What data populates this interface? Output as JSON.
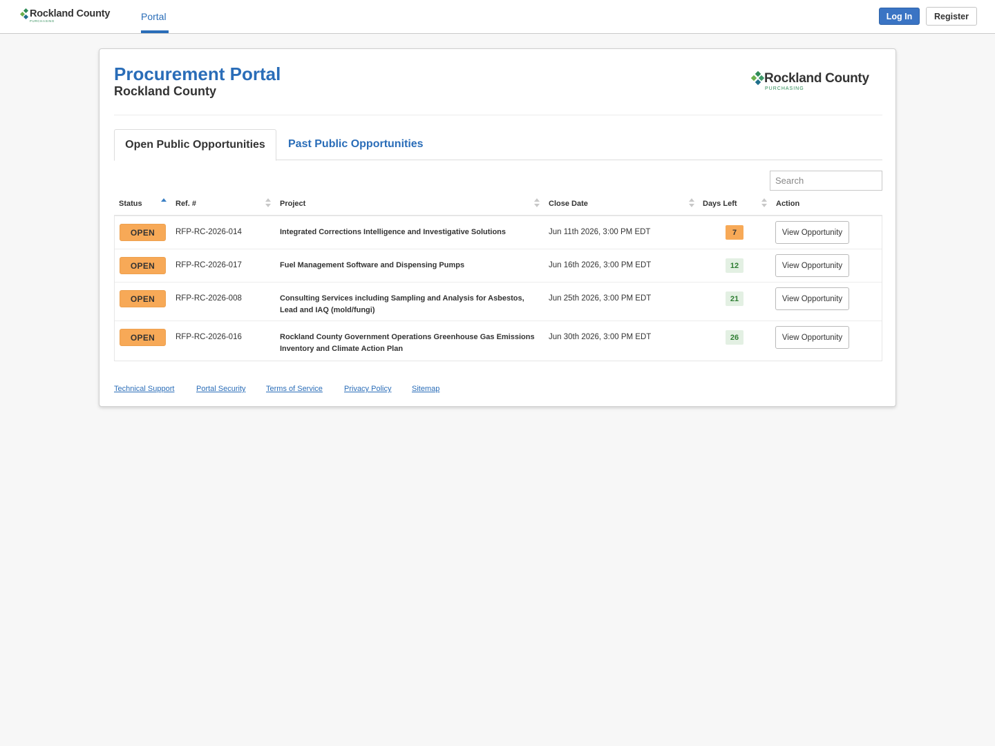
{
  "nav": {
    "logo": {
      "name": "Rockland County",
      "sub": "PURCHASING"
    },
    "portal_tab": "Portal",
    "login_label": "Log In",
    "register_label": "Register"
  },
  "header": {
    "title": "Procurement Portal",
    "subtitle": "Rockland County",
    "logo": {
      "name": "Rockland County",
      "sub": "PURCHASING"
    }
  },
  "tabs": {
    "open": "Open Public Opportunities",
    "past": "Past Public Opportunities"
  },
  "search": {
    "placeholder": "Search"
  },
  "table": {
    "headers": {
      "status": "Status",
      "ref": "Ref. #",
      "project": "Project",
      "close_date": "Close Date",
      "days_left": "Days Left",
      "action": "Action"
    },
    "rows": [
      {
        "status": "OPEN",
        "ref": "RFP-RC-2026-014",
        "project": "Integrated Corrections Intelligence and Investigative Solutions",
        "close_date": "Jun 11th 2026, 3:00 PM EDT",
        "days_left": "7",
        "action": "View Opportunity"
      },
      {
        "status": "OPEN",
        "ref": "RFP-RC-2026-017",
        "project": "Fuel Management Software and Dispensing Pumps",
        "close_date": "Jun 16th 2026, 3:00 PM EDT",
        "days_left": "12",
        "action": "View Opportunity"
      },
      {
        "status": "OPEN",
        "ref": "RFP-RC-2026-008",
        "project": "Consulting Services including Sampling and Analysis for Asbestos, Lead and IAQ (mold/fungi)",
        "close_date": "Jun 25th 2026, 3:00 PM EDT",
        "days_left": "21",
        "action": "View Opportunity"
      },
      {
        "status": "OPEN",
        "ref": "RFP-RC-2026-016",
        "project": "Rockland County Government Operations Greenhouse Gas Emissions Inventory and Climate Action Plan",
        "close_date": "Jun 30th 2026, 3:00 PM EDT",
        "days_left": "26",
        "action": "View Opportunity"
      }
    ]
  },
  "footer": {
    "links": [
      "Technical Support",
      "Portal Security",
      "Terms of Service",
      "Privacy Policy",
      "Sitemap"
    ]
  },
  "colors": {
    "brand_blue": "#2a6db8",
    "login_blue": "#3a74c4",
    "status_orange": "#f7a957",
    "days_ok_bg": "#e3f0e3",
    "days_ok_text": "#2e7d32",
    "logo_green": "#2e8b57"
  },
  "icons": [
    "logo-diamond-icon",
    "sort-asc-icon",
    "sort-icon"
  ]
}
